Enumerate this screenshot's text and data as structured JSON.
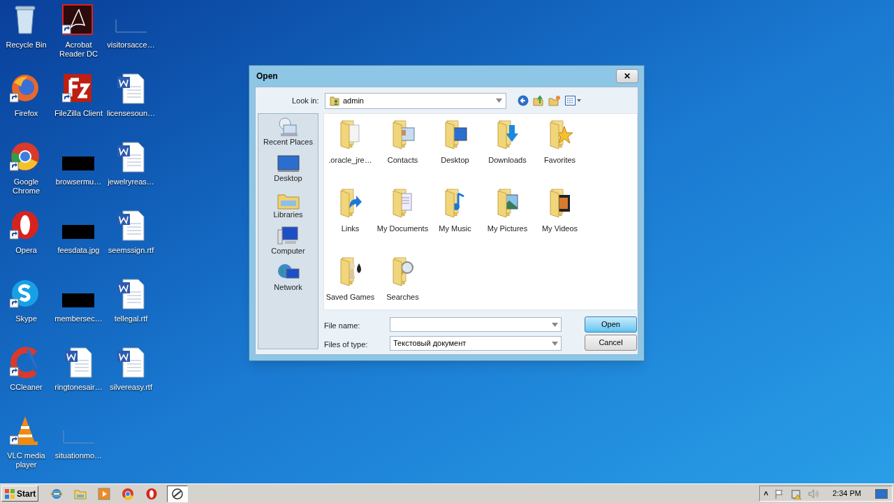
{
  "desktop": {
    "columns": [
      {
        "icons": [
          {
            "label": "Recycle Bin",
            "kind": "recycle",
            "shortcut": false
          },
          {
            "label": "Firefox",
            "kind": "firefox",
            "shortcut": true
          },
          {
            "label": "Google Chrome",
            "kind": "chrome",
            "shortcut": true
          },
          {
            "label": "Opera",
            "kind": "opera",
            "shortcut": true
          },
          {
            "label": "Skype",
            "kind": "skype",
            "shortcut": true
          },
          {
            "label": "CCleaner",
            "kind": "ccleaner",
            "shortcut": true
          },
          {
            "label": "VLC media player",
            "kind": "vlc",
            "shortcut": true
          }
        ]
      },
      {
        "icons": [
          {
            "label": "Acrobat Reader DC",
            "kind": "acrobat",
            "shortcut": true
          },
          {
            "label": "FileZilla Client",
            "kind": "filezilla",
            "shortcut": true
          },
          {
            "label": "browsermu…",
            "kind": "thumb",
            "shortcut": false
          },
          {
            "label": "feesdata.jpg",
            "kind": "thumb",
            "shortcut": false
          },
          {
            "label": "membersec…",
            "kind": "thumb",
            "shortcut": false
          },
          {
            "label": "ringtonesair…",
            "kind": "word",
            "shortcut": false
          },
          {
            "label": "situationmo…",
            "kind": "blank",
            "shortcut": false
          }
        ]
      },
      {
        "icons": [
          {
            "label": "visitorsacce…",
            "kind": "blank",
            "shortcut": false
          },
          {
            "label": "licensesoun…",
            "kind": "word",
            "shortcut": false
          },
          {
            "label": "jewelryreas…",
            "kind": "word",
            "shortcut": false
          },
          {
            "label": "seemssign.rtf",
            "kind": "word",
            "shortcut": false
          },
          {
            "label": "tellegal.rtf",
            "kind": "word",
            "shortcut": false
          },
          {
            "label": "silvereasy.rtf",
            "kind": "word",
            "shortcut": false
          }
        ]
      }
    ]
  },
  "dialog": {
    "title": "Open",
    "close": "✕",
    "look_in": {
      "label": "Look in:",
      "value": "admin"
    },
    "places": [
      {
        "label": "Recent Places",
        "kind": "recent"
      },
      {
        "label": "Desktop",
        "kind": "desktop"
      },
      {
        "label": "Libraries",
        "kind": "libraries"
      },
      {
        "label": "Computer",
        "kind": "computer"
      },
      {
        "label": "Network",
        "kind": "network"
      }
    ],
    "files": [
      {
        "label": ".oracle_jre…",
        "kind": "plain"
      },
      {
        "label": "Contacts",
        "kind": "contacts"
      },
      {
        "label": "Desktop",
        "kind": "desktop"
      },
      {
        "label": "Downloads",
        "kind": "downloads"
      },
      {
        "label": "Favorites",
        "kind": "favorites"
      },
      {
        "label": "Links",
        "kind": "links"
      },
      {
        "label": "My Documents",
        "kind": "documents"
      },
      {
        "label": "My Music",
        "kind": "music"
      },
      {
        "label": "My Pictures",
        "kind": "pictures"
      },
      {
        "label": "My Videos",
        "kind": "videos"
      },
      {
        "label": "Saved Games",
        "kind": "games"
      },
      {
        "label": "Searches",
        "kind": "searches"
      }
    ],
    "file_name": {
      "label": "File name:"
    },
    "file_type": {
      "label": "Files of type:",
      "value": "Текстовый документ"
    },
    "buttons": [
      {
        "label": "Open",
        "default": true
      },
      {
        "label": "Cancel",
        "default": false
      }
    ]
  },
  "taskbar": {
    "start": "Start",
    "items": [
      {
        "kind": "ie",
        "active": false
      },
      {
        "kind": "explorer",
        "active": false
      },
      {
        "kind": "media",
        "active": false
      },
      {
        "kind": "chrome",
        "active": false
      },
      {
        "kind": "opera",
        "active": false
      },
      {
        "kind": "app",
        "active": true
      }
    ],
    "tray": {
      "chevron": "˄",
      "time": "2:34 PM"
    }
  }
}
